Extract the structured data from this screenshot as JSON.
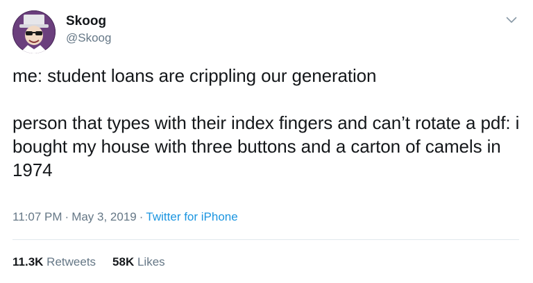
{
  "author": {
    "display_name": "Skoog",
    "handle": "@Skoog",
    "avatar_icon": "user-avatar"
  },
  "tweet": {
    "line1": "me: student loans are crippling our generation",
    "line2": "person that types with their index fingers and can’t rotate a pdf: i bought my house with three buttons and a carton of camels in 1974"
  },
  "meta": {
    "time": "11:07 PM",
    "date": "May 3, 2019",
    "separator": "·",
    "source": "Twitter for iPhone"
  },
  "stats": {
    "retweets_count": "11.3K",
    "retweets_label": "Retweets",
    "likes_count": "58K",
    "likes_label": "Likes"
  },
  "colors": {
    "text": "#14171a",
    "secondary": "#657786",
    "link": "#1b95e0",
    "divider": "#e1e8ed"
  }
}
